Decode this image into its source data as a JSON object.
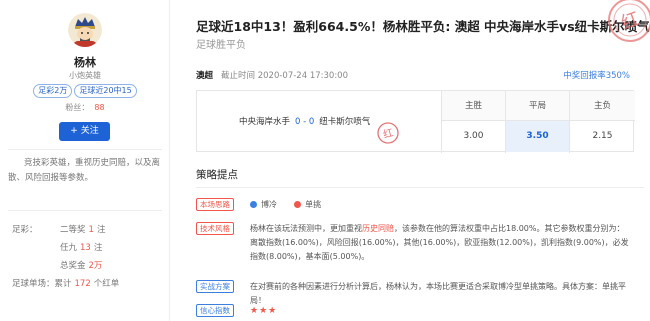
{
  "sidebar": {
    "name": "杨林",
    "title": "小炮英雄",
    "tags": [
      "足彩2万",
      "足球近20中15"
    ],
    "fans_label": "粉丝：",
    "fans_count": "88",
    "follow_label": "关注",
    "bio": "竞技彩英雄，重视历史同赔，以及离散、风险回报等参数。",
    "stats": {
      "zucai_label": "足彩：",
      "erdengjiang_label": "二等奖",
      "erdengjiang_value": "1",
      "erdengjiang_unit": "注",
      "renjiu_label": "任九",
      "renjiu_value": "13",
      "renjiu_unit": "注",
      "total_label": "总奖金",
      "total_value": "2万",
      "single_label": "足球单场：累计",
      "single_value": "172",
      "single_unit": "个红单"
    }
  },
  "article": {
    "headline": "足球近18中13！盈利664.5%！杨林胜平负: 澳超 中央海岸水手vs纽卡斯尔喷气",
    "subline": "足球胜平负",
    "stamp_text": "红",
    "league": "澳超",
    "deadline": "截止时间 2020-07-24 17:30:00",
    "hit_rate": "中奖回报率350%",
    "match": {
      "home": "中央海岸水手",
      "score": "0 - 0",
      "away": "纽卡斯尔喷气",
      "mini_stamp_text": "红"
    },
    "odds": [
      {
        "label": "主胜",
        "value": "3.00",
        "selected": false
      },
      {
        "label": "平局",
        "value": "3.50",
        "selected": true
      },
      {
        "label": "主负",
        "value": "2.15",
        "selected": false
      }
    ],
    "section_title": "策略提点",
    "strategy": {
      "label": "本场思路",
      "cold_label": "博冷",
      "single_label": "单挑",
      "cold_color": "#3b80e0",
      "single_color": "#f0574a"
    },
    "tech": {
      "label": "技术风格",
      "text_pre": "杨林在该玩法预测中，更加重视",
      "text_highlight": "历史同赔",
      "text_post": "，该参数在他的算法权重中占比18.00%。其它参数权重分别为：离散指数(16.00%)，风险回报(16.00%)，其他(16.00%)，欧亚指数(12.00%)，凯利指数(9.00%)，必发指数(8.00%)，基本面(5.00%)。"
    },
    "plan": {
      "label": "实战方案",
      "text": "在对赛前的各种因素进行分析计算后，杨林认为，本场比赛更适合采取博冷型单挑策略。具体方案：单挑平局！"
    },
    "confidence": {
      "label": "信心指数",
      "stars": "★★★"
    }
  },
  "colors": {
    "accent": "#1d63d6",
    "red": "#f0574a",
    "blue": "#3b80e0"
  }
}
